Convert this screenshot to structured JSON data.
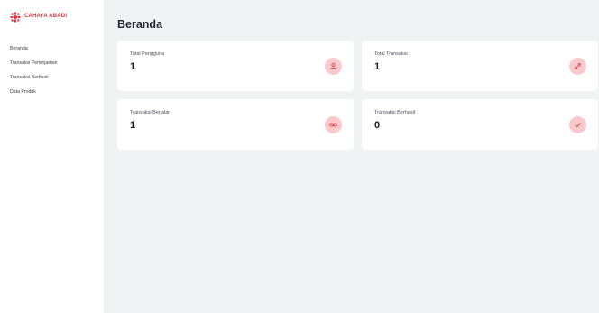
{
  "brand": {
    "name": "CAHAYA ABADI",
    "color": "#e0313f",
    "icon": "brand-logo-icon"
  },
  "sidebar": {
    "items": [
      {
        "label": "Beranda"
      },
      {
        "label": "Transaksi Peminjaman"
      },
      {
        "label": "Transaksi Berhasil"
      },
      {
        "label": "Data Produk"
      }
    ]
  },
  "page": {
    "title": "Beranda"
  },
  "cards": [
    {
      "label": "Total Pengguna",
      "value": "1",
      "icon": "user-icon"
    },
    {
      "label": "Total Transaksi",
      "value": "1",
      "icon": "arrows-icon"
    },
    {
      "label": "Transaksi Berjalan",
      "value": "1",
      "icon": "link-icon"
    },
    {
      "label": "Transaksi Berhasil",
      "value": "0",
      "icon": "check-icon"
    }
  ],
  "colors": {
    "accent": "#e0313f",
    "badge_bg": "#f9c9cc",
    "main_bg": "#f1f2f4"
  }
}
